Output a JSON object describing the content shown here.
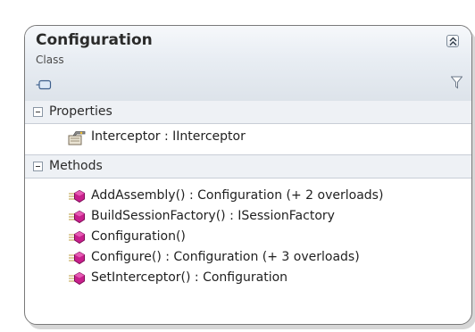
{
  "class_box": {
    "title": "Configuration",
    "stereotype": "Class",
    "colors": {
      "border": "#7a7a7a",
      "header": "#e8edf3",
      "method_icon": "#c8208c"
    }
  },
  "properties": {
    "label": "Properties",
    "items": [
      {
        "text": "Interceptor : IInterceptor",
        "icon": "property-icon"
      }
    ]
  },
  "methods": {
    "label": "Methods",
    "items": [
      {
        "text": "AddAssembly() : Configuration (+ 2 overloads)",
        "icon": "method-icon"
      },
      {
        "text": "BuildSessionFactory() : ISessionFactory",
        "icon": "method-icon"
      },
      {
        "text": "Configuration()",
        "icon": "method-icon"
      },
      {
        "text": "Configure() : Configuration (+ 3 overloads)",
        "icon": "method-icon"
      },
      {
        "text": "SetInterceptor() : Configuration",
        "icon": "method-icon"
      }
    ]
  }
}
